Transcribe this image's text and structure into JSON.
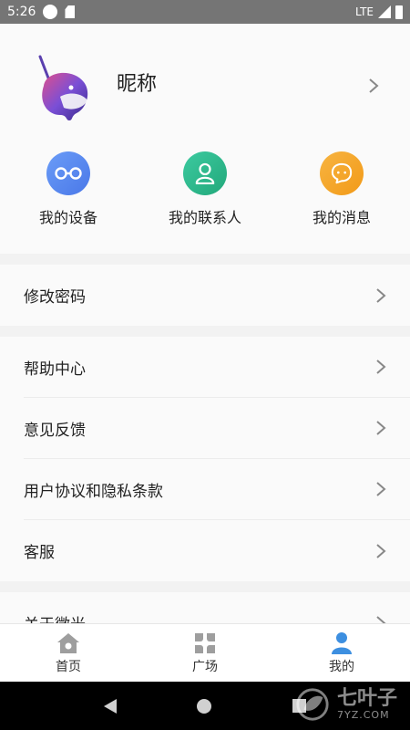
{
  "status_bar": {
    "time": "5:26",
    "network": "LTE"
  },
  "profile": {
    "nickname": "昵称"
  },
  "shortcuts": [
    {
      "label": "我的设备",
      "icon": "glasses-icon",
      "color": "#5b8df5"
    },
    {
      "label": "我的联系人",
      "icon": "person-icon",
      "color": "#2fb98c"
    },
    {
      "label": "我的消息",
      "icon": "chat-bubble-icon",
      "color": "#f5a623"
    }
  ],
  "menu": {
    "group1": [
      {
        "label": "修改密码"
      }
    ],
    "group2": [
      {
        "label": "帮助中心"
      },
      {
        "label": "意见反馈"
      },
      {
        "label": "用户协议和隐私条款"
      },
      {
        "label": "客服"
      }
    ],
    "group3": [
      {
        "label": "关于微光"
      }
    ]
  },
  "tabbar": [
    {
      "label": "首页",
      "icon": "home-icon",
      "active": false
    },
    {
      "label": "广场",
      "icon": "square-grid-icon",
      "active": false
    },
    {
      "label": "我的",
      "icon": "user-icon",
      "active": true
    }
  ],
  "watermark": {
    "main": "七叶子",
    "sub": "7YZ.COM"
  },
  "colors": {
    "accent_blue": "#3d8fe0",
    "inactive_icon": "#9e9e9e"
  }
}
